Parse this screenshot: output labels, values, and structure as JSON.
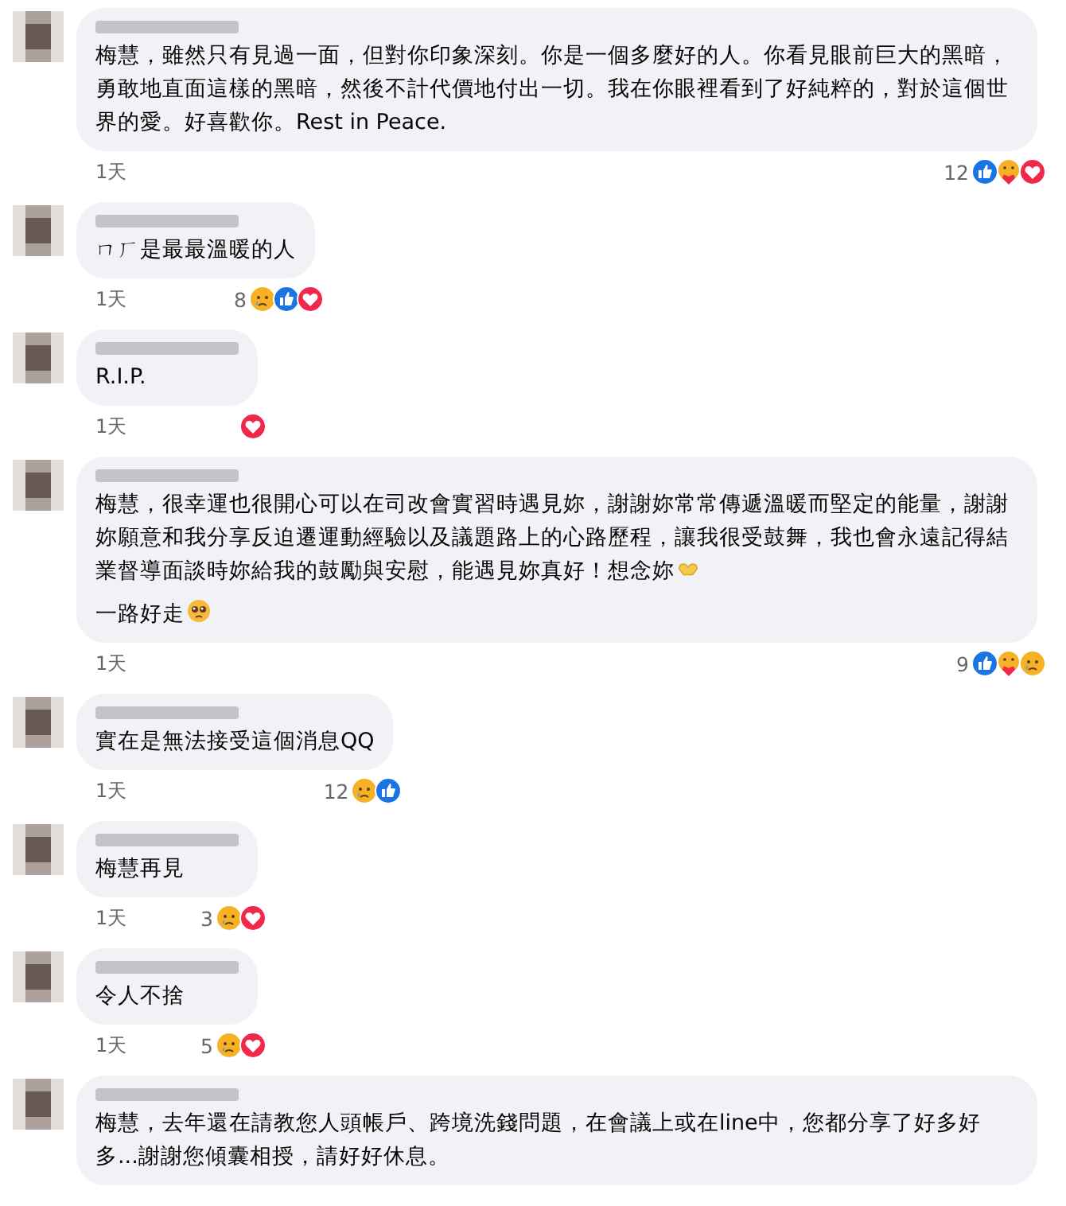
{
  "comments": [
    {
      "paragraphs": [
        {
          "text": "梅慧，雖然只有見過一面，但對你印象深刻。你是一個多麼好的人。你看見眼前巨大的黑暗，勇敢地直面這樣的黑暗，然後不計代價地付出一切。我在你眼裡看到了好純粹的，對於這個世界的愛。好喜歡你。Rest in Peace."
        }
      ],
      "time": "1天",
      "reaction_count": "12",
      "reactions": [
        {
          "kind": "like"
        },
        {
          "kind": "care"
        },
        {
          "kind": "love"
        }
      ]
    },
    {
      "paragraphs": [
        {
          "text": "ㄇㄏ是最最溫暖的人"
        }
      ],
      "time": "1天",
      "reaction_count": "8",
      "reactions": [
        {
          "kind": "sad"
        },
        {
          "kind": "like"
        },
        {
          "kind": "love"
        }
      ]
    },
    {
      "paragraphs": [
        {
          "text": "R.I.P."
        }
      ],
      "time": "1天",
      "reactions": [
        {
          "kind": "love"
        }
      ]
    },
    {
      "paragraphs": [
        {
          "text": "梅慧，很幸運也很開心可以在司改會實習時遇見妳，謝謝妳常常傳遞溫暖而堅定的能量，謝謝妳願意和我分享反迫遷運動經驗以及議題路上的心路歷程，讓我很受鼓舞，我也會永遠記得結業督導面談時妳給我的鼓勵與安慰，能遇見妳真好！想念妳",
          "kind": "heart-hands"
        },
        {
          "text": "一路好走",
          "kind": "pleading"
        }
      ],
      "time": "1天",
      "reaction_count": "9",
      "reactions": [
        {
          "kind": "like"
        },
        {
          "kind": "care"
        },
        {
          "kind": "sad"
        }
      ]
    },
    {
      "paragraphs": [
        {
          "text": "實在是無法接受這個消息QQ"
        }
      ],
      "time": "1天",
      "reaction_count": "12",
      "reactions": [
        {
          "kind": "sad"
        },
        {
          "kind": "like"
        }
      ]
    },
    {
      "paragraphs": [
        {
          "text": "梅慧再見"
        }
      ],
      "time": "1天",
      "reaction_count": "3",
      "reactions": [
        {
          "kind": "sad"
        },
        {
          "kind": "love"
        }
      ]
    },
    {
      "paragraphs": [
        {
          "text": "令人不捨"
        }
      ],
      "time": "1天",
      "reaction_count": "5",
      "reactions": [
        {
          "kind": "sad"
        },
        {
          "kind": "love"
        }
      ]
    },
    {
      "paragraphs": [
        {
          "text": "梅慧，去年還在請教您人頭帳戶、跨境洗錢問題，在會議上或在line中，您都分享了好多好多...謝謝您傾囊相授，請好好休息。"
        }
      ]
    }
  ]
}
